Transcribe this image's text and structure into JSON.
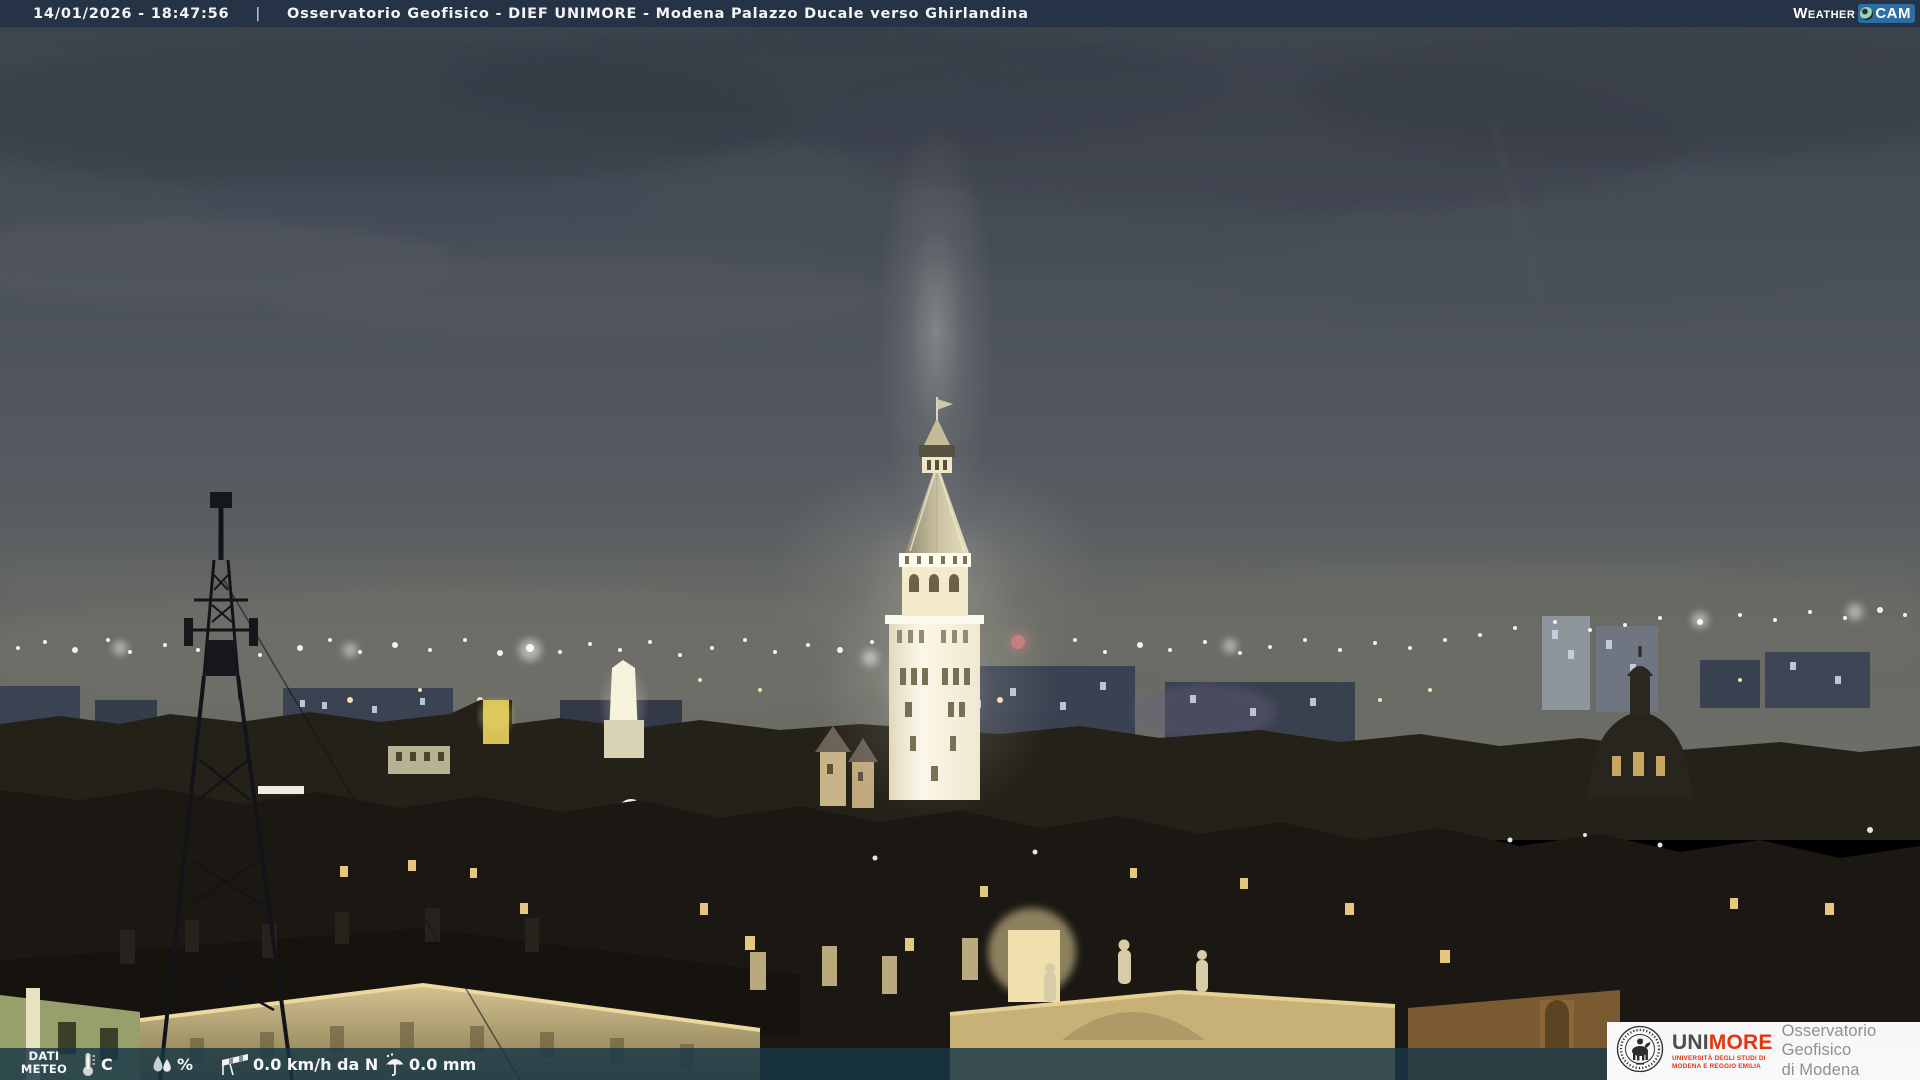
{
  "header": {
    "timestamp": "14/01/2026 - 18:47:56",
    "separator": "|",
    "title": "Osservatorio Geofisico - DIEF UNIMORE - Modena Palazzo Ducale verso Ghirlandina"
  },
  "watermark": {
    "weather": "WEATHER",
    "cam": "CAM"
  },
  "footer": {
    "dati_line1": "DATI",
    "dati_line2": "METEO",
    "temperature_value": "C",
    "humidity_value": "%",
    "wind_value": "0.0 km/h da N",
    "rain_value": "0.0 mm"
  },
  "branding": {
    "wordmark_uni": "UNI",
    "wordmark_more": "MORE",
    "university_line1": "UNIVERSITÀ DEGLI STUDI DI",
    "university_line2": "MODENA E REGGIO EMILIA",
    "org_line1": "Osservatorio Geofisico",
    "org_line2": "di Modena"
  },
  "icons": {
    "thermometer-icon": "thermometer",
    "humidity-icon": "water-drops",
    "windsock-icon": "windsock",
    "rain-icon": "umbrella-with-rain",
    "weathercam-lens-icon": "camera-lens",
    "unimore-seal-icon": "university-seal"
  },
  "colors": {
    "top_bar": "#253244",
    "bottom_bar": "#173747",
    "weathercam_blue": "#2e6da4",
    "unimore_red": "#e63312",
    "unimore_grey": "#4d4d4f",
    "org_text_grey": "#8d9192"
  }
}
